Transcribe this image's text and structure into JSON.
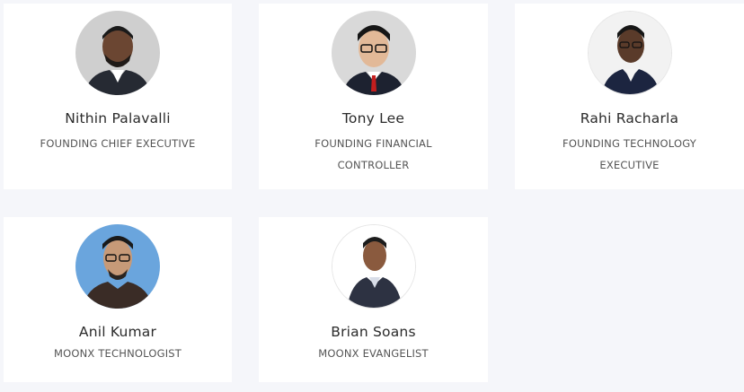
{
  "team": [
    {
      "name": "Nithin Palavalli",
      "role": "FOUNDING CHIEF EXECUTIVE",
      "avatar_bg": "#cfcfcf"
    },
    {
      "name": "Tony Lee",
      "role": "FOUNDING FINANCIAL CONTROLLER",
      "avatar_bg": "#d9d9d9"
    },
    {
      "name": "Rahi Racharla",
      "role": "FOUNDING TECHNOLOGY EXECUTIVE",
      "avatar_bg": "#f2f2f2"
    },
    {
      "name": "Anil Kumar",
      "role": "MOONX TECHNOLOGIST",
      "avatar_bg": "#6aa5dd"
    },
    {
      "name": "Brian Soans",
      "role": "MOONX EVANGELIST",
      "avatar_bg": "#ffffff"
    }
  ]
}
